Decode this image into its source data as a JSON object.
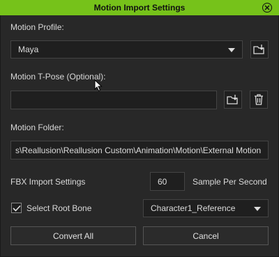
{
  "window": {
    "title": "Motion Import Settings"
  },
  "motion_profile": {
    "label": "Motion Profile:",
    "selected": "Maya"
  },
  "tpose": {
    "label": "Motion T-Pose (Optional):",
    "value": ""
  },
  "motion_folder": {
    "label": "Motion Folder:",
    "value": "s\\Reallusion\\Reallusion Custom\\Animation\\Motion\\External Motion"
  },
  "fbx": {
    "label": "FBX Import Settings",
    "sample_value": "60",
    "sample_label": "Sample Per Second"
  },
  "root_bone": {
    "checkbox_label": "Select Root Bone",
    "checked": true,
    "selected": "Character1_Reference"
  },
  "buttons": {
    "convert_all": "Convert All",
    "cancel": "Cancel"
  },
  "colors": {
    "title_bar": "#76c21a",
    "background": "#282828"
  },
  "icons": [
    "close-icon",
    "folder-import-icon",
    "trash-icon",
    "dropdown-arrow-icon",
    "checkmark-icon",
    "mouse-cursor-icon"
  ]
}
